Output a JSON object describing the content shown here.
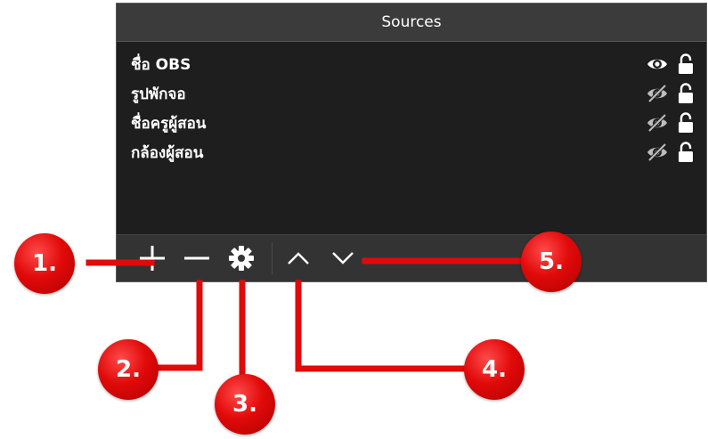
{
  "panel": {
    "title": "Sources",
    "sources": [
      {
        "name": "ชื่อ OBS",
        "visible": true,
        "visibility_icon": "eye-icon",
        "lock_icon": "lock-open-icon"
      },
      {
        "name": "รูปพักจอ",
        "visible": false,
        "visibility_icon": "eye-slash-icon",
        "lock_icon": "lock-open-icon"
      },
      {
        "name": "ชื่อครูผู้สอน",
        "visible": false,
        "visibility_icon": "eye-slash-icon",
        "lock_icon": "lock-open-icon"
      },
      {
        "name": "กล้องผู้สอน",
        "visible": false,
        "visibility_icon": "eye-slash-icon",
        "lock_icon": "lock-open-icon"
      }
    ],
    "toolbar": [
      {
        "icon": "plus-icon"
      },
      {
        "icon": "minus-icon"
      },
      {
        "icon": "gear-icon"
      },
      {
        "icon": "chevron-up-icon"
      },
      {
        "icon": "chevron-down-icon"
      }
    ]
  },
  "callouts": {
    "marker_1": "1.",
    "marker_2": "2.",
    "marker_3": "3.",
    "marker_4": "4.",
    "marker_5": "5."
  },
  "colors": {
    "panel_bg": "#1e1e1e",
    "titlebar_bg": "#3b3b3b",
    "toolbar_bg": "#333333",
    "text": "#ffffff",
    "callout_red": "#e10a0a"
  }
}
